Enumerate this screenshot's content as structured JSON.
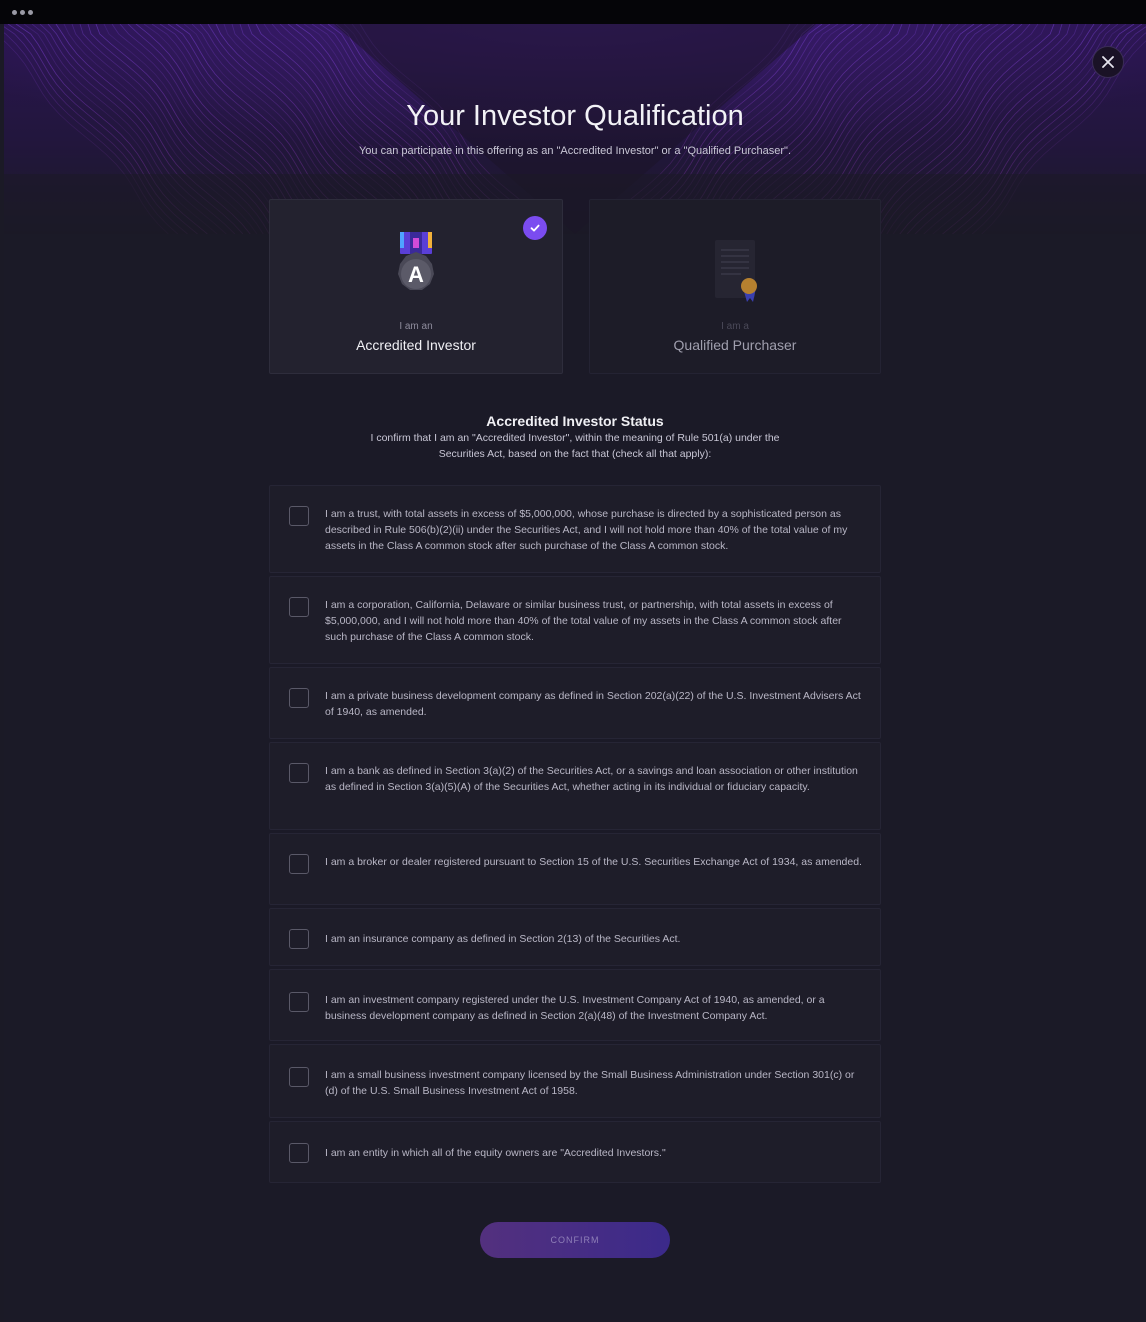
{
  "modal": {
    "title": "Your Investor Qualification",
    "subtitle": "You can participate in this offering as an \"Accredited Investor\" or a \"Qualified Purchaser\".",
    "close_icon": "close-icon"
  },
  "investor_types": [
    {
      "prefix": "I am an",
      "label": "Accredited Investor",
      "icon": "medal-icon",
      "selected": true
    },
    {
      "prefix": "I am a",
      "label": "Qualified Purchaser",
      "icon": "certificate-icon",
      "selected": false
    }
  ],
  "status": {
    "title": "Accredited Investor Status",
    "description": "I confirm that I am an \"Accredited Investor\", within the meaning of Rule 501(a) under the Securities Act, based on the fact that (check all that apply):"
  },
  "options": [
    {
      "text": "I am a trust, with total assets in excess of $5,000,000, whose purchase is directed by a sophisticated person as described in Rule 506(b)(2)(ii) under the Securities Act, and I will not hold more than 40% of the total value of my assets in the Class A common stock after such purchase of the Class A common stock.",
      "checked": false
    },
    {
      "text": "I am a corporation, California, Delaware or similar business trust, or partnership, with total assets in excess of $5,000,000, and I will not hold more than 40% of the total value of my assets in the Class A common stock after such purchase of the Class A common stock.",
      "checked": false
    },
    {
      "text": "I am a private business development company as defined in Section 202(a)(22) of the U.S. Investment Advisers Act of 1940, as amended.",
      "checked": false
    },
    {
      "text": "I am a bank as defined in Section 3(a)(2) of the Securities Act, or a savings and loan association or other institution as defined in Section 3(a)(5)(A) of the Securities Act, whether acting in its individual or fiduciary capacity.",
      "checked": false
    },
    {
      "text": "I am a broker or dealer registered pursuant to Section 15 of the U.S. Securities Exchange Act of 1934, as amended.",
      "checked": false
    },
    {
      "text": "I am an insurance company as defined in Section 2(13) of the Securities Act.",
      "checked": false
    },
    {
      "text": "I am an investment company registered under the U.S. Investment Company Act of 1940, as amended, or a business development company as defined in Section 2(a)(48) of the Investment Company Act.",
      "checked": false
    },
    {
      "text": "I am a small business investment company licensed by the Small Business Administration under Section 301(c) or (d) of the U.S. Small Business Investment Act of 1958.",
      "checked": false
    },
    {
      "text": "I am an entity in which all of the equity owners are \"Accredited Investors.\"",
      "checked": false
    }
  ],
  "confirm_label": "CONFIRM",
  "colors": {
    "accent": "#7b4cf0",
    "background": "#1b1a27",
    "hero_purple": "#6b2fd0",
    "confirm_gradient_start": "#53307e",
    "confirm_gradient_end": "#3b2a8a"
  }
}
